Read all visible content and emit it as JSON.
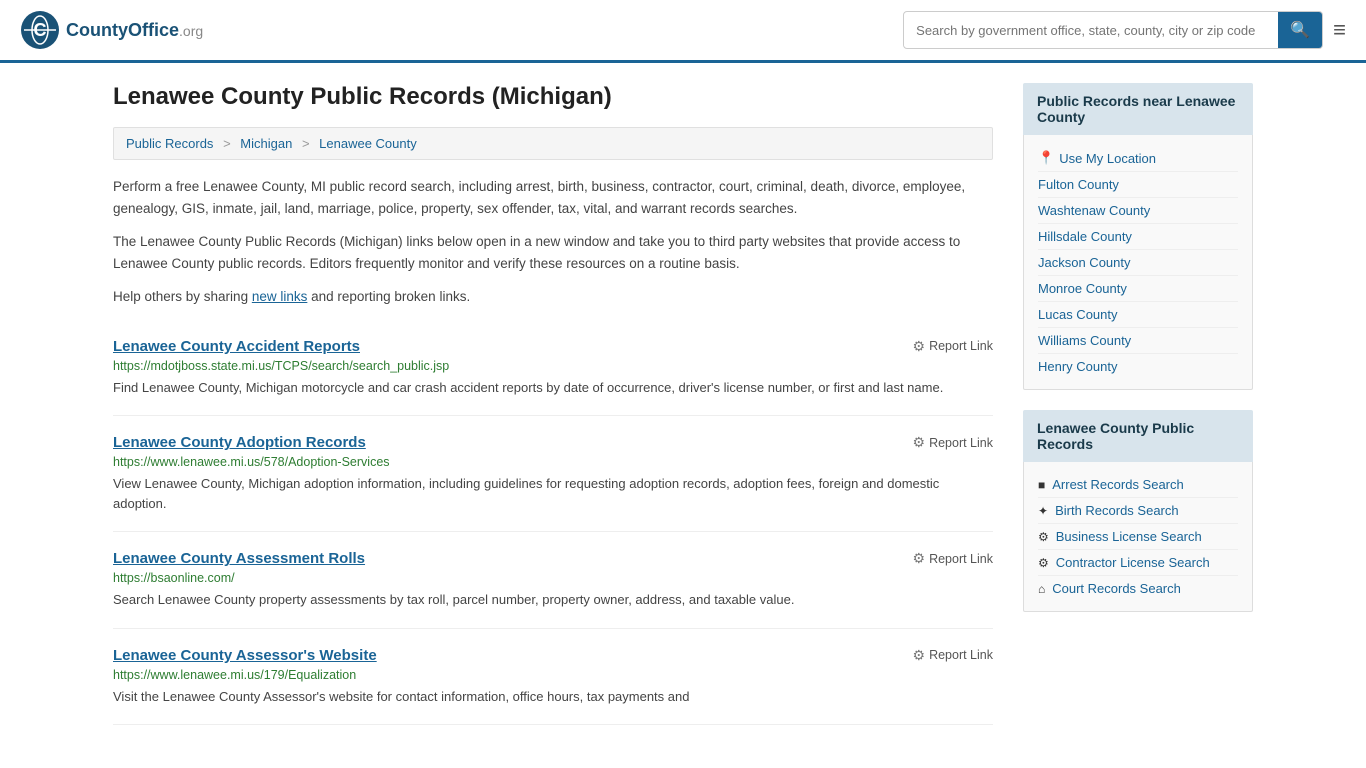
{
  "header": {
    "logo_text": "CountyOffice",
    "logo_suffix": ".org",
    "search_placeholder": "Search by government office, state, county, city or zip code",
    "search_value": ""
  },
  "page": {
    "title": "Lenawee County Public Records (Michigan)",
    "breadcrumb": [
      {
        "label": "Public Records",
        "href": "#"
      },
      {
        "label": "Michigan",
        "href": "#"
      },
      {
        "label": "Lenawee County",
        "href": "#"
      }
    ],
    "description1": "Perform a free Lenawee County, MI public record search, including arrest, birth, business, contractor, court, criminal, death, divorce, employee, genealogy, GIS, inmate, jail, land, marriage, police, property, sex offender, tax, vital, and warrant records searches.",
    "description2": "The Lenawee County Public Records (Michigan) links below open in a new window and take you to third party websites that provide access to Lenawee County public records. Editors frequently monitor and verify these resources on a routine basis.",
    "description3_pre": "Help others by sharing ",
    "description3_link": "new links",
    "description3_post": " and reporting broken links.",
    "records": [
      {
        "title": "Lenawee County Accident Reports",
        "url": "https://mdotjboss.state.mi.us/TCPS/search/search_public.jsp",
        "desc": "Find Lenawee County, Michigan motorcycle and car crash accident reports by date of occurrence, driver's license number, or first and last name.",
        "report_label": "Report Link"
      },
      {
        "title": "Lenawee County Adoption Records",
        "url": "https://www.lenawee.mi.us/578/Adoption-Services",
        "desc": "View Lenawee County, Michigan adoption information, including guidelines for requesting adoption records, adoption fees, foreign and domestic adoption.",
        "report_label": "Report Link"
      },
      {
        "title": "Lenawee County Assessment Rolls",
        "url": "https://bsaonline.com/",
        "desc": "Search Lenawee County property assessments by tax roll, parcel number, property owner, address, and taxable value.",
        "report_label": "Report Link"
      },
      {
        "title": "Lenawee County Assessor's Website",
        "url": "https://www.lenawee.mi.us/179/Equalization",
        "desc": "Visit the Lenawee County Assessor's website for contact information, office hours, tax payments and",
        "report_label": "Report Link"
      }
    ]
  },
  "sidebar": {
    "nearby_header": "Public Records near Lenawee County",
    "use_my_location": "Use My Location",
    "nearby_counties": [
      "Fulton County",
      "Washtenaw County",
      "Hillsdale County",
      "Jackson County",
      "Monroe County",
      "Lucas County",
      "Williams County",
      "Henry County"
    ],
    "records_header": "Lenawee County Public Records",
    "record_links": [
      {
        "label": "Arrest Records Search",
        "icon": "■"
      },
      {
        "label": "Birth Records Search",
        "icon": "✦"
      },
      {
        "label": "Business License Search",
        "icon": "⚙"
      },
      {
        "label": "Contractor License Search",
        "icon": "⚙"
      },
      {
        "label": "Court Records Search",
        "icon": "⌂"
      }
    ]
  }
}
